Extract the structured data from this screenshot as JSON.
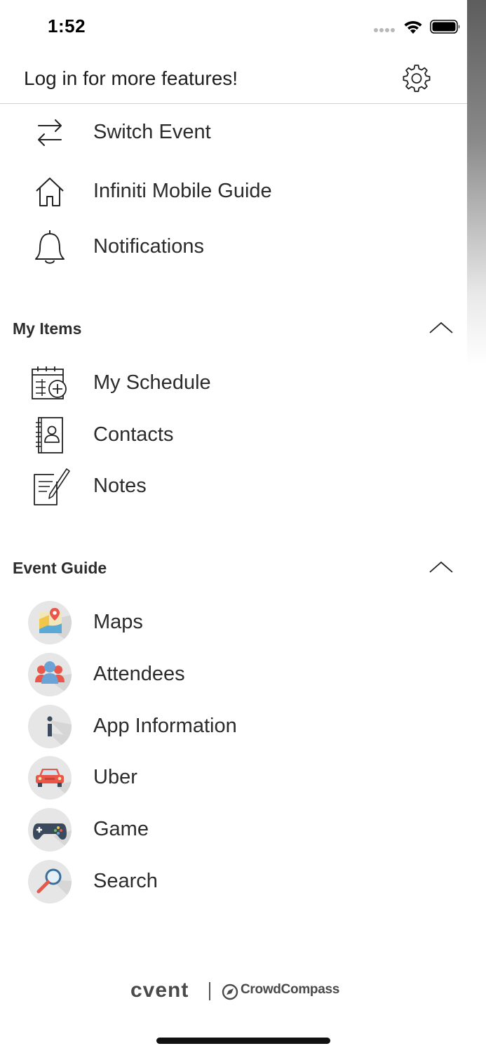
{
  "status_bar": {
    "time": "1:52"
  },
  "header": {
    "login_prompt": "Log in for more features!"
  },
  "top_items": [
    {
      "label": "Switch Event",
      "icon": "switch-arrows-icon"
    },
    {
      "label": "Infiniti Mobile Guide",
      "icon": "home-icon"
    },
    {
      "label": "Notifications",
      "icon": "bell-icon"
    }
  ],
  "my_items": {
    "title": "My Items",
    "items": [
      {
        "label": "My Schedule",
        "icon": "calendar-add-icon"
      },
      {
        "label": "Contacts",
        "icon": "address-book-icon"
      },
      {
        "label": "Notes",
        "icon": "note-pencil-icon"
      }
    ]
  },
  "event_guide": {
    "title": "Event Guide",
    "items": [
      {
        "label": "Maps",
        "icon": "map-pin-icon"
      },
      {
        "label": "Attendees",
        "icon": "people-icon"
      },
      {
        "label": "App Information",
        "icon": "info-icon"
      },
      {
        "label": "Uber",
        "icon": "car-icon"
      },
      {
        "label": "Game",
        "icon": "gamepad-icon"
      },
      {
        "label": "Search",
        "icon": "magnifier-icon"
      }
    ]
  },
  "footer": {
    "brand_primary": "cvent",
    "brand_secondary": "CrowdCompass"
  },
  "colors": {
    "text": "#2b2b2b",
    "divider": "#d3d3d3",
    "icon_circle": "#e6e6e6"
  }
}
